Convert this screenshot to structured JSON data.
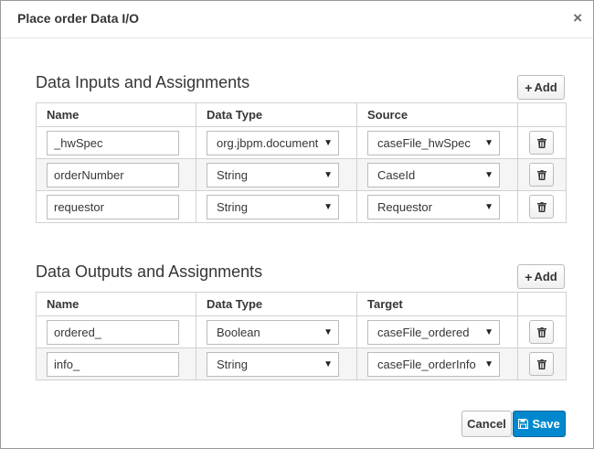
{
  "dialog": {
    "title": "Place order Data I/O",
    "close_glyph": "×"
  },
  "inputs": {
    "heading": "Data Inputs and Assignments",
    "add_label": "Add",
    "columns": [
      "Name",
      "Data Type",
      "Source"
    ],
    "rows": [
      {
        "name": "_hwSpec",
        "data_type": "org.jbpm.document",
        "source": "caseFile_hwSpec"
      },
      {
        "name": "orderNumber",
        "data_type": "String",
        "source": "CaseId"
      },
      {
        "name": "requestor",
        "data_type": "String",
        "source": "Requestor"
      }
    ]
  },
  "outputs": {
    "heading": "Data Outputs and Assignments",
    "add_label": "Add",
    "columns": [
      "Name",
      "Data Type",
      "Target"
    ],
    "rows": [
      {
        "name": "ordered_",
        "data_type": "Boolean",
        "target": "caseFile_ordered"
      },
      {
        "name": "info_",
        "data_type": "String",
        "target": "caseFile_orderInfo"
      }
    ]
  },
  "footer": {
    "cancel_label": "Cancel",
    "save_label": "Save"
  },
  "icons": {
    "add": "plus-icon",
    "delete": "trash-icon",
    "save": "floppy-disk-icon",
    "close": "close-icon",
    "dropdown": "caret-down-icon"
  },
  "colors": {
    "primary": "#0088ce",
    "border": "#bbbbbb",
    "row_alt": "#f5f5f5"
  }
}
